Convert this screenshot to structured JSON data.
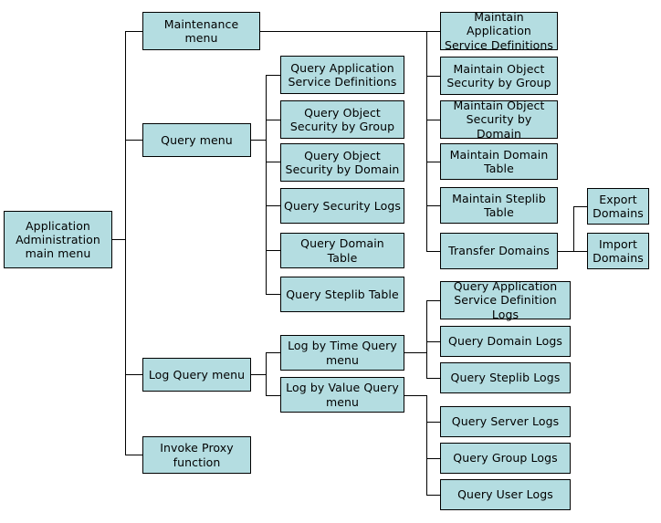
{
  "diagram": {
    "title": "Application Administration main menu structure",
    "colors": {
      "node_fill": "#b4dde1",
      "node_border": "#000000",
      "connector": "#000000",
      "background": "#ffffff",
      "text": "#000000"
    }
  },
  "nodes": {
    "root": {
      "label": "Application Administration main menu"
    },
    "level1": [
      {
        "label": "Maintenance menu"
      },
      {
        "label": "Query menu"
      },
      {
        "label": "Log Query menu"
      },
      {
        "label": "Invoke Proxy function"
      }
    ],
    "maintenance_children": [
      {
        "label": "Maintain Application Service Definitions"
      },
      {
        "label": "Maintain Object Security by Group"
      },
      {
        "label": "Maintain Object Security by Domain"
      },
      {
        "label": "Maintain Domain Table"
      },
      {
        "label": "Maintain Steplib Table"
      },
      {
        "label": "Transfer Domains"
      }
    ],
    "transfer_children": [
      {
        "label": "Export Domains"
      },
      {
        "label": "Import Domains"
      }
    ],
    "query_children": [
      {
        "label": "Query Application Service Definitions"
      },
      {
        "label": "Query Object Security by Group"
      },
      {
        "label": "Query Object Security by Domain"
      },
      {
        "label": "Query Security Logs"
      },
      {
        "label": "Query Domain Table"
      },
      {
        "label": "Query Steplib Table"
      }
    ],
    "log_query_children": [
      {
        "label": "Log by Time Query menu"
      },
      {
        "label": "Log by Value Query menu"
      }
    ],
    "log_by_time_children": [
      {
        "label": "Query Application Service Definition Logs"
      },
      {
        "label": "Query Domain Logs"
      },
      {
        "label": "Query Steplib Logs"
      }
    ],
    "log_by_value_children": [
      {
        "label": "Query Server Logs"
      },
      {
        "label": "Query Group Logs"
      },
      {
        "label": "Query User Logs"
      }
    ]
  }
}
